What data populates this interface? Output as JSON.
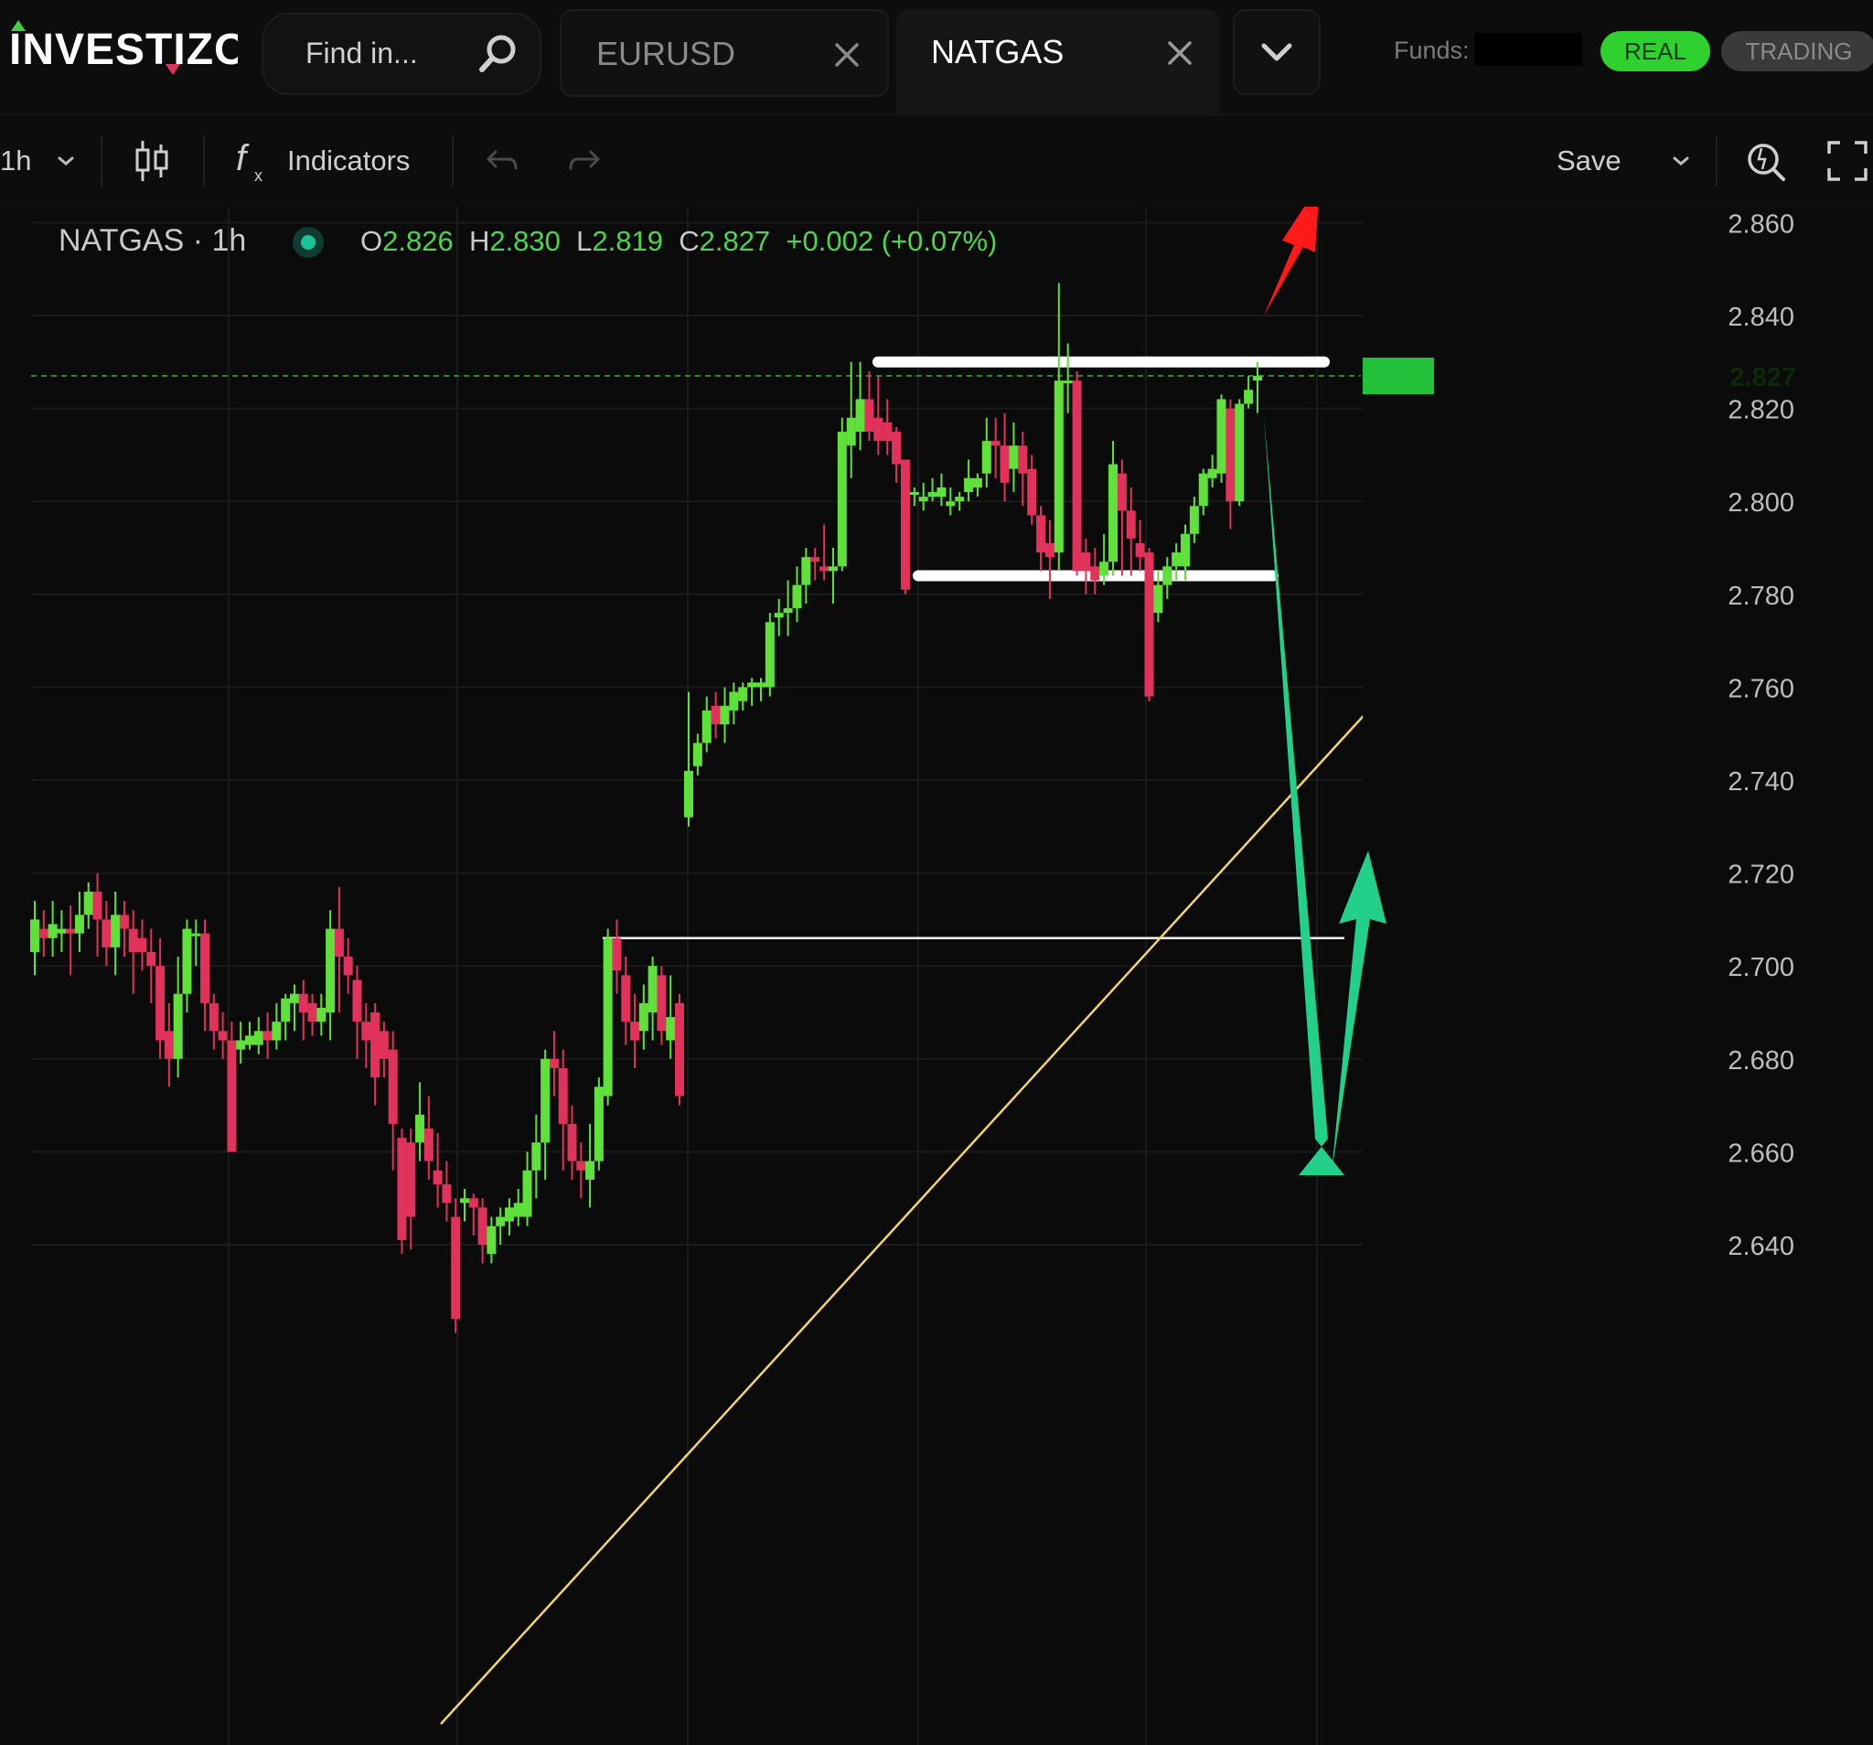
{
  "app": {
    "logo_text": "INVESTIZO"
  },
  "search": {
    "placeholder": "Find in..."
  },
  "tabs": [
    {
      "label": "EURUSD",
      "active": false
    },
    {
      "label": "NATGAS",
      "active": true
    }
  ],
  "account": {
    "funds_label": "Funds:",
    "mode_real": "REAL",
    "mode_trading": "TRADING"
  },
  "toolbar": {
    "interval": "1h",
    "indicators_label": "Indicators",
    "save_label": "Save"
  },
  "legend": {
    "symbol": "NATGAS · 1h",
    "open_key": "O",
    "open": "2.826",
    "high_key": "H",
    "high": "2.830",
    "low_key": "L",
    "low": "2.819",
    "close_key": "C",
    "close": "2.827",
    "change": "+0.002 (+0.07%)"
  },
  "colors": {
    "up": "#5fe03a",
    "down": "#e0325a",
    "trendline": "#f2d46b",
    "annotation_white": "#ffffff",
    "arrow_red": "#ff1a1a",
    "arrow_green": "#22d08a",
    "price_tag": "#22c13a"
  },
  "chart_data": {
    "type": "candlestick",
    "symbol": "NATGAS",
    "interval": "1h",
    "ylim": [
      2.62,
      2.868
    ],
    "y_ticks": [
      "2.860",
      "2.840",
      "2.820",
      "2.800",
      "2.780",
      "2.760",
      "2.740",
      "2.720",
      "2.700",
      "2.680",
      "2.660",
      "2.640"
    ],
    "last_price": "2.827",
    "levels": [
      2.83,
      2.784,
      2.706
    ],
    "candles": [
      [
        2.703,
        2.71,
        2.698,
        2.714
      ],
      [
        2.708,
        2.706,
        2.702,
        2.712
      ],
      [
        2.706,
        2.709,
        2.702,
        2.714
      ],
      [
        2.707,
        2.708,
        2.703,
        2.712
      ],
      [
        2.708,
        2.707,
        2.698,
        2.713
      ],
      [
        2.707,
        2.711,
        2.703,
        2.716
      ],
      [
        2.711,
        2.716,
        2.708,
        2.718
      ],
      [
        2.716,
        2.71,
        2.702,
        2.72
      ],
      [
        2.71,
        2.704,
        2.7,
        2.714
      ],
      [
        2.704,
        2.711,
        2.698,
        2.716
      ],
      [
        2.711,
        2.708,
        2.702,
        2.714
      ],
      [
        2.708,
        2.703,
        2.694,
        2.712
      ],
      [
        2.706,
        2.703,
        2.699,
        2.71
      ],
      [
        2.703,
        2.7,
        2.692,
        2.708
      ],
      [
        2.7,
        2.684,
        2.68,
        2.706
      ],
      [
        2.686,
        2.68,
        2.674,
        2.692
      ],
      [
        2.68,
        2.694,
        2.676,
        2.702
      ],
      [
        2.694,
        2.708,
        2.69,
        2.71
      ],
      [
        2.707,
        2.707,
        2.7,
        2.71
      ],
      [
        2.707,
        2.692,
        2.686,
        2.71
      ],
      [
        2.692,
        2.686,
        2.682,
        2.694
      ],
      [
        2.686,
        2.684,
        2.68,
        2.69
      ],
      [
        2.684,
        2.66,
        2.66,
        2.688
      ],
      [
        2.682,
        2.684,
        2.679,
        2.688
      ],
      [
        2.683,
        2.685,
        2.682,
        2.688
      ],
      [
        2.683,
        2.686,
        2.681,
        2.689
      ],
      [
        2.686,
        2.684,
        2.68,
        2.69
      ],
      [
        2.684,
        2.688,
        2.682,
        2.692
      ],
      [
        2.688,
        2.693,
        2.684,
        2.694
      ],
      [
        2.692,
        2.694,
        2.686,
        2.696
      ],
      [
        2.694,
        2.69,
        2.684,
        2.697
      ],
      [
        2.692,
        2.688,
        2.685,
        2.694
      ],
      [
        2.688,
        2.691,
        2.685,
        2.694
      ],
      [
        2.69,
        2.708,
        2.684,
        2.712
      ],
      [
        2.708,
        2.702,
        2.69,
        2.717
      ],
      [
        2.702,
        2.698,
        2.694,
        2.706
      ],
      [
        2.697,
        2.688,
        2.68,
        2.7
      ],
      [
        2.688,
        2.684,
        2.678,
        2.692
      ],
      [
        2.69,
        2.676,
        2.67,
        2.692
      ],
      [
        2.686,
        2.68,
        2.676,
        2.688
      ],
      [
        2.682,
        2.666,
        2.656,
        2.686
      ],
      [
        2.663,
        2.641,
        2.638,
        2.665
      ],
      [
        2.662,
        2.646,
        2.639,
        2.665
      ],
      [
        2.662,
        2.668,
        2.658,
        2.675
      ],
      [
        2.665,
        2.658,
        2.654,
        2.672
      ],
      [
        2.656,
        2.653,
        2.648,
        2.664
      ],
      [
        2.653,
        2.649,
        2.645,
        2.658
      ],
      [
        2.646,
        2.624,
        2.621,
        2.65
      ],
      [
        2.649,
        2.65,
        2.645,
        2.652
      ],
      [
        2.65,
        2.648,
        2.642,
        2.651
      ],
      [
        2.648,
        2.64,
        2.636,
        2.65
      ],
      [
        2.638,
        2.644,
        2.636,
        2.646
      ],
      [
        2.644,
        2.646,
        2.64,
        2.648
      ],
      [
        2.645,
        2.648,
        2.642,
        2.65
      ],
      [
        2.646,
        2.649,
        2.644,
        2.652
      ],
      [
        2.646,
        2.656,
        2.644,
        2.66
      ],
      [
        2.656,
        2.662,
        2.65,
        2.668
      ],
      [
        2.662,
        2.68,
        2.654,
        2.682
      ],
      [
        2.68,
        2.678,
        2.672,
        2.686
      ],
      [
        2.678,
        2.666,
        2.656,
        2.682
      ],
      [
        2.666,
        2.658,
        2.654,
        2.67
      ],
      [
        2.658,
        2.656,
        2.65,
        2.662
      ],
      [
        2.654,
        2.658,
        2.648,
        2.666
      ],
      [
        2.658,
        2.674,
        2.656,
        2.676
      ],
      [
        2.672,
        2.706,
        2.67,
        2.708
      ],
      [
        2.706,
        2.699,
        2.694,
        2.71
      ],
      [
        2.698,
        2.688,
        2.683,
        2.702
      ],
      [
        2.688,
        2.684,
        2.678,
        2.694
      ],
      [
        2.686,
        2.692,
        2.682,
        2.696
      ],
      [
        2.69,
        2.7,
        2.684,
        2.702
      ],
      [
        2.698,
        2.686,
        2.683,
        2.7
      ],
      [
        2.684,
        2.689,
        2.68,
        2.698
      ],
      [
        2.692,
        2.672,
        2.67,
        2.694
      ],
      [
        2.732,
        2.742,
        2.73,
        2.759
      ],
      [
        2.743,
        2.748,
        2.741,
        2.75
      ],
      [
        2.748,
        2.755,
        2.746,
        2.758
      ],
      [
        2.756,
        2.752,
        2.749,
        2.759
      ],
      [
        2.752,
        2.756,
        2.748,
        2.76
      ],
      [
        2.755,
        2.759,
        2.752,
        2.761
      ],
      [
        2.757,
        2.76,
        2.755,
        2.761
      ],
      [
        2.76,
        2.761,
        2.756,
        2.762
      ],
      [
        2.76,
        2.761,
        2.757,
        2.762
      ],
      [
        2.76,
        2.774,
        2.758,
        2.776
      ],
      [
        2.775,
        2.776,
        2.771,
        2.779
      ],
      [
        2.776,
        2.777,
        2.771,
        2.783
      ],
      [
        2.777,
        2.782,
        2.774,
        2.786
      ],
      [
        2.782,
        2.788,
        2.778,
        2.79
      ],
      [
        2.788,
        2.787,
        2.783,
        2.79
      ],
      [
        2.786,
        2.785,
        2.783,
        2.795
      ],
      [
        2.785,
        2.786,
        2.778,
        2.79
      ],
      [
        2.786,
        2.815,
        2.785,
        2.818
      ],
      [
        2.812,
        2.818,
        2.805,
        2.83
      ],
      [
        2.815,
        2.822,
        2.811,
        2.83
      ],
      [
        2.822,
        2.815,
        2.813,
        2.828
      ],
      [
        2.818,
        2.813,
        2.81,
        2.827
      ],
      [
        2.817,
        2.813,
        2.81,
        2.822
      ],
      [
        2.815,
        2.808,
        2.804,
        2.816
      ],
      [
        2.809,
        2.781,
        2.78,
        2.809
      ],
      [
        2.802,
        2.802,
        2.799,
        2.803
      ],
      [
        2.8,
        2.801,
        2.798,
        2.804
      ],
      [
        2.801,
        2.802,
        2.8,
        2.805
      ],
      [
        2.801,
        2.803,
        2.799,
        2.806
      ],
      [
        2.799,
        2.8,
        2.797,
        2.803
      ],
      [
        2.8,
        2.801,
        2.798,
        2.802
      ],
      [
        2.802,
        2.805,
        2.8,
        2.809
      ],
      [
        2.803,
        2.805,
        2.801,
        2.806
      ],
      [
        2.806,
        2.813,
        2.803,
        2.818
      ],
      [
        2.813,
        2.812,
        2.805,
        2.818
      ],
      [
        2.812,
        2.804,
        2.8,
        2.819
      ],
      [
        2.807,
        2.812,
        2.802,
        2.817
      ],
      [
        2.812,
        2.806,
        2.799,
        2.815
      ],
      [
        2.807,
        2.797,
        2.795,
        2.81
      ],
      [
        2.797,
        2.789,
        2.785,
        2.799
      ],
      [
        2.791,
        2.788,
        2.779,
        2.796
      ],
      [
        2.789,
        2.826,
        2.785,
        2.847
      ],
      [
        2.826,
        2.826,
        2.819,
        2.834
      ],
      [
        2.826,
        2.785,
        2.784,
        2.828
      ],
      [
        2.789,
        2.785,
        2.78,
        2.792
      ],
      [
        2.786,
        2.783,
        2.78,
        2.79
      ],
      [
        2.784,
        2.787,
        2.782,
        2.793
      ],
      [
        2.787,
        2.808,
        2.784,
        2.813
      ],
      [
        2.806,
        2.798,
        2.784,
        2.809
      ],
      [
        2.798,
        2.792,
        2.784,
        2.803
      ],
      [
        2.791,
        2.788,
        2.785,
        2.796
      ],
      [
        2.789,
        2.758,
        2.757,
        2.79
      ],
      [
        2.776,
        2.782,
        2.774,
        2.785
      ],
      [
        2.782,
        2.786,
        2.779,
        2.788
      ],
      [
        2.786,
        2.789,
        2.783,
        2.791
      ],
      [
        2.786,
        2.793,
        2.783,
        2.795
      ],
      [
        2.793,
        2.799,
        2.791,
        2.801
      ],
      [
        2.799,
        2.806,
        2.797,
        2.807
      ],
      [
        2.805,
        2.807,
        2.803,
        2.81
      ],
      [
        2.806,
        2.822,
        2.804,
        2.823
      ],
      [
        2.82,
        2.8,
        2.794,
        2.822
      ],
      [
        2.8,
        2.821,
        2.799,
        2.822
      ],
      [
        2.821,
        2.824,
        2.82,
        2.827
      ],
      [
        2.826,
        2.827,
        2.819,
        2.83
      ]
    ]
  }
}
